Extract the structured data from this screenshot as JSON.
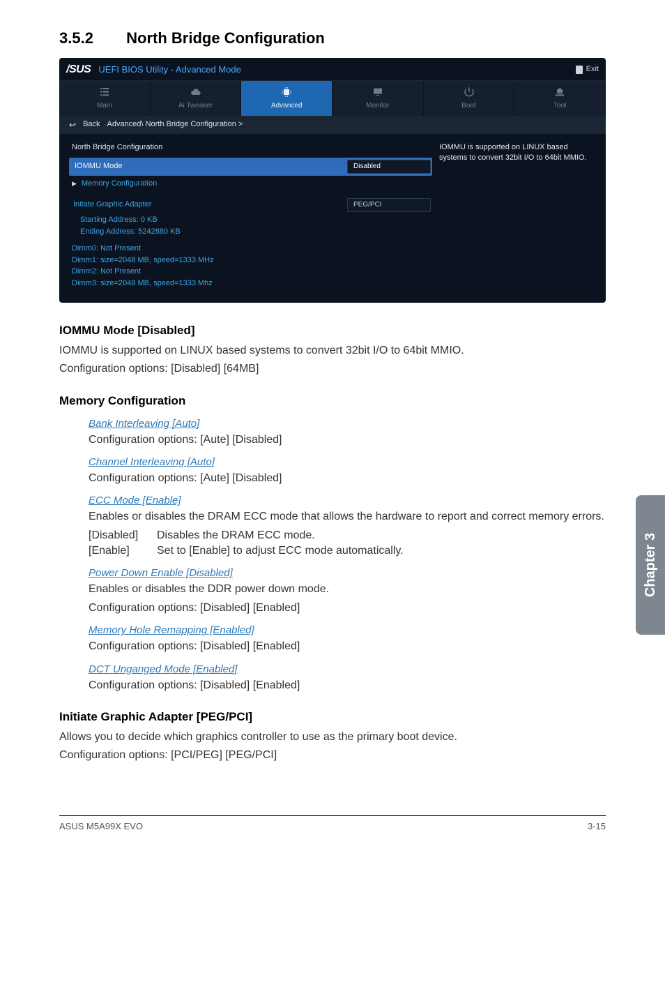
{
  "section": {
    "number": "3.5.2",
    "title": "North Bridge Configuration"
  },
  "bios": {
    "brand": "/SUS",
    "title": "UEFI BIOS Utility - Advanced Mode",
    "exit": "Exit",
    "tabs": {
      "main": "Main",
      "ai_tweaker": "Ai  Tweaker",
      "advanced": "Advanced",
      "monitor": "Monitor",
      "boot": "Boot",
      "tool": "Tool"
    },
    "back": "Back",
    "breadcrumb": "Advanced\\ North Bridge Configuration  >",
    "panel_title": "North Bridge Configuration",
    "rows": {
      "iommu_label": "IOMMU Mode",
      "iommu_value": "Disabled",
      "memcfg": "Memory Configuration",
      "initgfx_label": "Initate Graphic Adapter",
      "initgfx_value": "PEG/PCI",
      "start_addr": "Starting Address:  0  KB",
      "end_addr": "Ending Address:  5242880  KB",
      "dimm0": "Dimm0: Not Present",
      "dimm1": "Dimm1: size=2048 MB, speed=1333 MHz",
      "dimm2": "Dimm2: Not Present",
      "dimm3": "Dimm3: size=2048 MB, speed=1333 Mhz"
    },
    "help": "IOMMU is supported on LINUX based systems to convert 32bit I/O to 64bit MMIO."
  },
  "content": {
    "iommu_h": "IOMMU Mode [Disabled]",
    "iommu_t1": "IOMMU is supported on LINUX based systems to convert 32bit I/O to 64bit MMIO.",
    "iommu_t2": "Configuration options: [Disabled] [64MB]",
    "memcfg_h": "Memory Configuration",
    "bank_h": "Bank Interleaving [Auto]",
    "bank_t": "Configuration options: [Aute] [Disabled]",
    "chan_h": "Channel Interleaving [Auto]",
    "chan_t": "Configuration options: [Aute] [Disabled]",
    "ecc_h": "ECC Mode [Enable]",
    "ecc_t": "Enables or disables the DRAM ECC mode that allows the hardware to report and correct memory errors.",
    "ecc_d_k": "[Disabled]",
    "ecc_d_v": "Disables the DRAM ECC mode.",
    "ecc_e_k": "[Enable]",
    "ecc_e_v": "Set to [Enable] to adjust ECC mode automatically.",
    "pwr_h": "Power Down Enable [Disabled]",
    "pwr_t1": "Enables or disables the DDR power down mode.",
    "pwr_t2": "Configuration options: [Disabled] [Enabled]",
    "hole_h": "Memory Hole Remapping [Enabled]",
    "hole_t": "Configuration options: [Disabled] [Enabled]",
    "dct_h": "DCT Unganged Mode [Enabled]",
    "dct_t": "Configuration options: [Disabled] [Enabled]",
    "gfx_h": "Initiate Graphic Adapter [PEG/PCI]",
    "gfx_t1": "Allows you to decide which graphics controller to use as the primary boot device.",
    "gfx_t2": "Configuration options: [PCI/PEG] [PEG/PCI]"
  },
  "sidebar": "Chapter 3",
  "footer": {
    "left": "ASUS M5A99X EVO",
    "right": "3-15"
  }
}
